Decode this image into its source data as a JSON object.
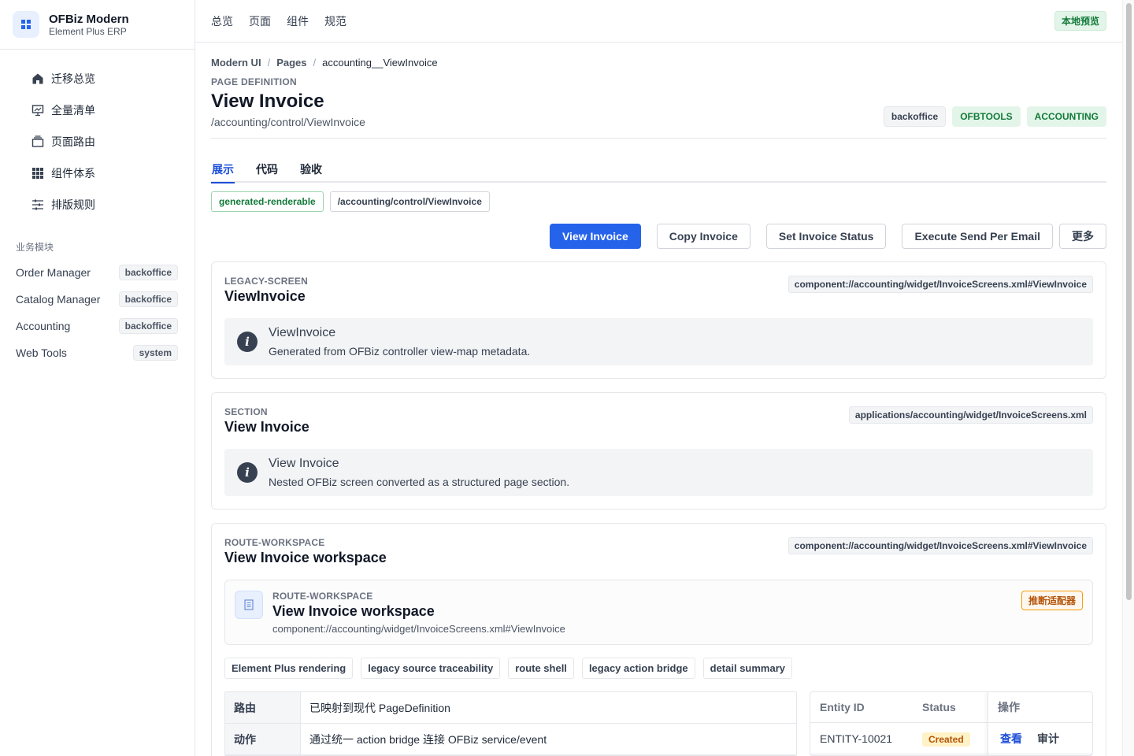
{
  "brand": {
    "title": "OFBiz Modern",
    "subtitle": "Element Plus ERP"
  },
  "nav": [
    {
      "label": "迁移总览",
      "icon": "home-icon"
    },
    {
      "label": "全量清单",
      "icon": "presentation-icon"
    },
    {
      "label": "页面路由",
      "icon": "stack-icon"
    },
    {
      "label": "组件体系",
      "icon": "grid-icon"
    },
    {
      "label": "排版规则",
      "icon": "sliders-icon"
    }
  ],
  "modules": {
    "title": "业务模块",
    "items": [
      {
        "label": "Order Manager",
        "badge": "backoffice"
      },
      {
        "label": "Catalog Manager",
        "badge": "backoffice"
      },
      {
        "label": "Accounting",
        "badge": "backoffice"
      },
      {
        "label": "Web Tools",
        "badge": "system"
      }
    ]
  },
  "topnav": [
    "总览",
    "页面",
    "组件",
    "规范"
  ],
  "preview_badge": "本地预览",
  "breadcrumb": {
    "root": "Modern UI",
    "mid": "Pages",
    "current": "accounting__ViewInvoice"
  },
  "page": {
    "eyebrow": "PAGE DEFINITION",
    "title": "View Invoice",
    "path": "/accounting/control/ViewInvoice",
    "tags": [
      "backoffice",
      "OFBTOOLS",
      "ACCOUNTING"
    ]
  },
  "tabs": [
    "展示",
    "代码",
    "验收"
  ],
  "chips": [
    "generated-renderable",
    "/accounting/control/ViewInvoice"
  ],
  "actions": [
    "View Invoice",
    "Copy Invoice",
    "Set Invoice Status",
    "Execute Send Per Email",
    "更多"
  ],
  "cards": [
    {
      "eyebrow": "LEGACY-SCREEN",
      "title": "ViewInvoice",
      "ref": "component://accounting/widget/InvoiceScreens.xml#ViewInvoice",
      "alert_title": "ViewInvoice",
      "alert_desc": "Generated from OFBiz controller view-map metadata."
    },
    {
      "eyebrow": "SECTION",
      "title": "View Invoice",
      "ref": "applications/accounting/widget/InvoiceScreens.xml",
      "alert_title": "View Invoice",
      "alert_desc": "Nested OFBiz screen converted as a structured page section."
    }
  ],
  "workspace": {
    "eyebrow": "ROUTE-WORKSPACE",
    "title": "View Invoice workspace",
    "ref": "component://accounting/widget/InvoiceScreens.xml#ViewInvoice",
    "panel": {
      "eyebrow": "ROUTE-WORKSPACE",
      "title": "View Invoice workspace",
      "path": "component://accounting/widget/InvoiceScreens.xml#ViewInvoice",
      "badge": "推断适配器"
    },
    "features": [
      "Element Plus rendering",
      "legacy source traceability",
      "route shell",
      "legacy action bridge",
      "detail summary"
    ],
    "kv": [
      {
        "key": "路由",
        "value": "已映射到现代 PageDefinition"
      },
      {
        "key": "动作",
        "value": "通过统一 action bridge 连接 OFBiz service/event"
      }
    ],
    "entity_table": {
      "headers": {
        "id": "Entity ID",
        "status": "Status",
        "ops": "操作"
      },
      "rows": [
        {
          "id": "ENTITY-10021",
          "status": "Created",
          "view": "查看",
          "audit": "审计"
        }
      ]
    }
  },
  "colors": {
    "primary": "#2563eb",
    "success": "#137a3a",
    "warning": "#b45309"
  }
}
